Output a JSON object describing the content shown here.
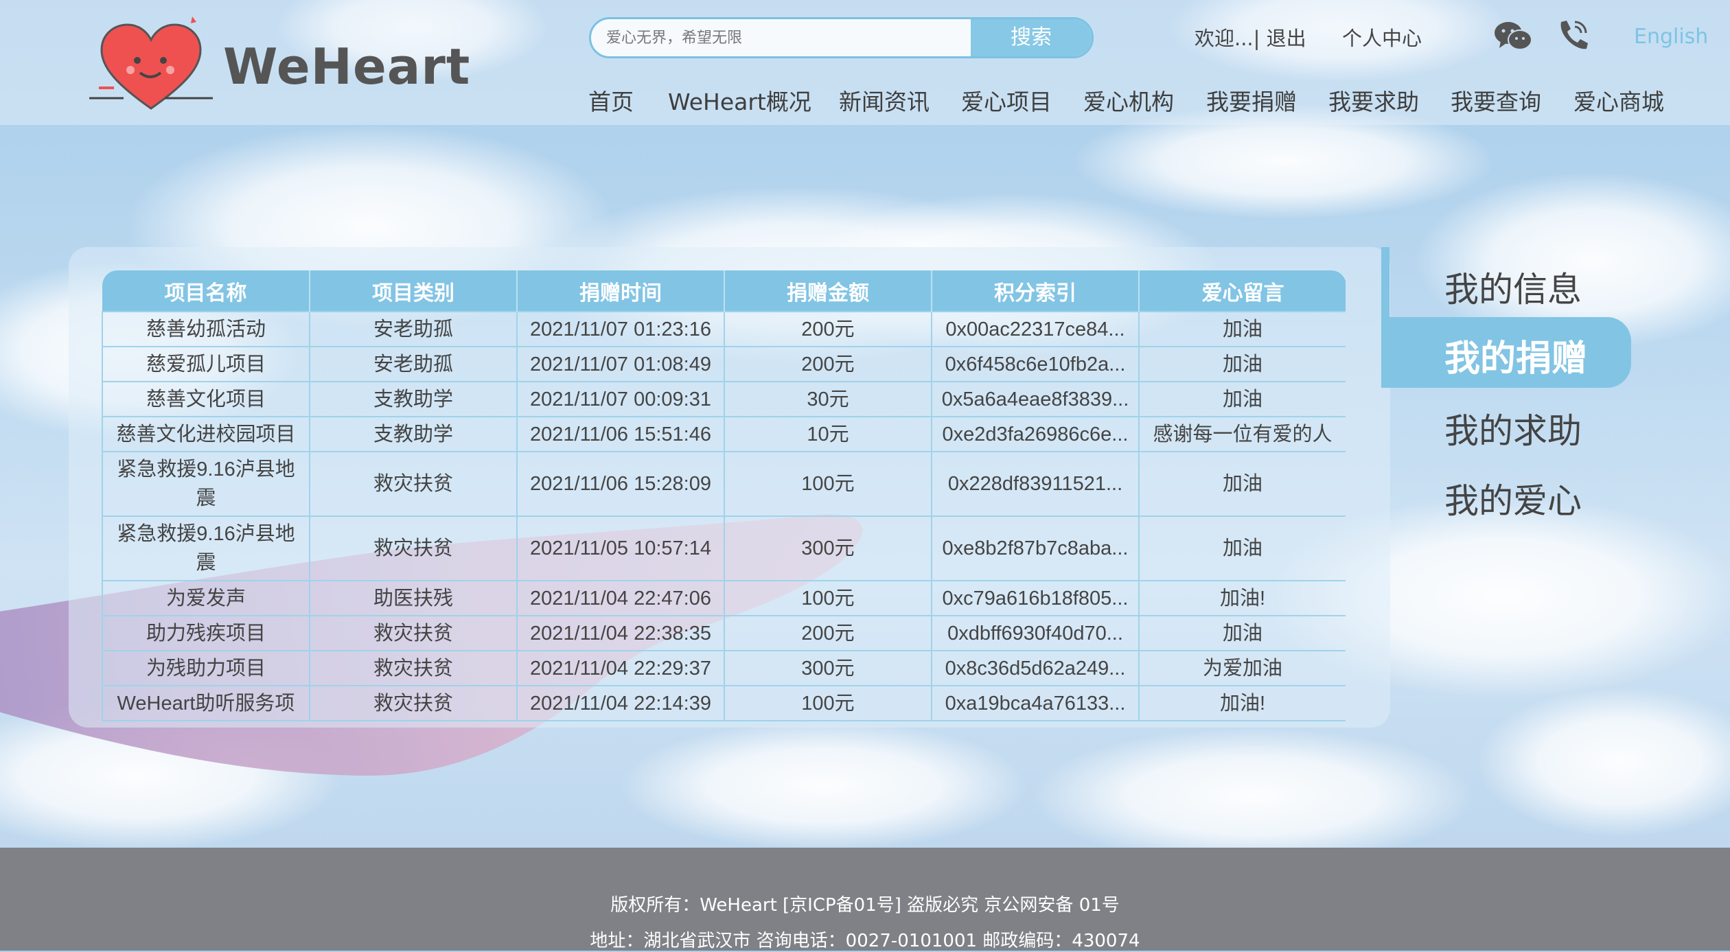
{
  "header": {
    "brand": "WeHeart",
    "search": {
      "placeholder": "爱心无界，希望无限",
      "button": "搜索"
    },
    "welcome": "欢迎...| 退出",
    "user_center": "个人中心",
    "language": "English",
    "nav": [
      "首页",
      "WeHeart概况",
      "新闻资讯",
      "爱心项目",
      "爱心机构",
      "我要捐赠",
      "我要求助",
      "我要查询",
      "爱心商城"
    ]
  },
  "table": {
    "columns": [
      "项目名称",
      "项目类别",
      "捐赠时间",
      "捐赠金额",
      "积分索引",
      "爱心留言"
    ],
    "rows": [
      [
        "慈善幼孤活动",
        "安老助孤",
        "2021/11/07 01:23:16",
        "200元",
        "0x00ac22317ce84...",
        "加油"
      ],
      [
        "慈爱孤儿项目",
        "安老助孤",
        "2021/11/07 01:08:49",
        "200元",
        "0x6f458c6e10fb2a...",
        "加油"
      ],
      [
        "慈善文化项目",
        "支教助学",
        "2021/11/07 00:09:31",
        "30元",
        "0x5a6a4eae8f3839...",
        "加油"
      ],
      [
        "慈善文化进校园项目",
        "支教助学",
        "2021/11/06 15:51:46",
        "10元",
        "0xe2d3fa26986c6e...",
        "感谢每一位有爱的人"
      ],
      [
        "紧急救援9.16泸县地震",
        "救灾扶贫",
        "2021/11/06 15:28:09",
        "100元",
        "0x228df83911521...",
        "加油"
      ],
      [
        "紧急救援9.16泸县地震",
        "救灾扶贫",
        "2021/11/05 10:57:14",
        "300元",
        "0xe8b2f87b7c8aba...",
        "加油"
      ],
      [
        "为爱发声",
        "助医扶残",
        "2021/11/04 22:47:06",
        "100元",
        "0xc79a616b18f805...",
        "加油!"
      ],
      [
        "助力残疾项目",
        "救灾扶贫",
        "2021/11/04 22:38:35",
        "200元",
        "0xdbff6930f40d70...",
        "加油"
      ],
      [
        "为残助力项目",
        "救灾扶贫",
        "2021/11/04 22:29:37",
        "300元",
        "0x8c36d5d62a249...",
        "为爱加油"
      ],
      [
        "WeHeart助听服务项",
        "救灾扶贫",
        "2021/11/04 22:14:39",
        "100元",
        "0xa19bca4a76133...",
        "加油!"
      ]
    ]
  },
  "side_menu": {
    "items": [
      "我的信息",
      "我的捐赠",
      "我的求助",
      "我的爱心"
    ],
    "active": "我的捐赠"
  },
  "footer": {
    "line1": "版权所有：WeHeart   [京ICP备01号] 盗版必究  京公网安备 01号",
    "line2": "地址：湖北省武汉市  咨询电话：0027-0101001  邮政编码：430074"
  },
  "icons": {
    "logo": "heart-logo-icon",
    "wechat": "wechat-icon",
    "phone": "phone-icon"
  },
  "colors": {
    "accent": "#82c4e4",
    "footer_bg": "#7f8186",
    "language": "#7cc4e6"
  }
}
